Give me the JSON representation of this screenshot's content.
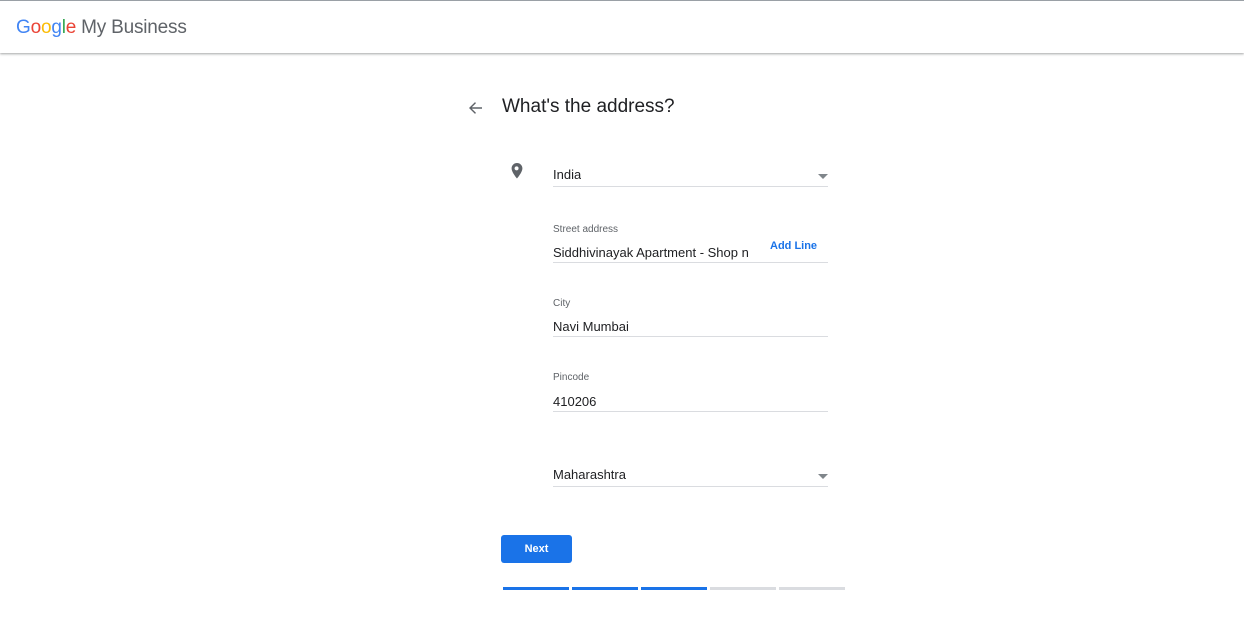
{
  "header": {
    "logo_letters": [
      "G",
      "o",
      "o",
      "g",
      "l",
      "e"
    ],
    "product_name": "My Business"
  },
  "page": {
    "title": "What's the address?"
  },
  "form": {
    "country": {
      "value": "India"
    },
    "street": {
      "label": "Street address",
      "value": "Siddhivinayak Apartment - Shop nc",
      "add_line": "Add Line"
    },
    "city": {
      "label": "City",
      "value": "Navi Mumbai"
    },
    "pincode": {
      "label": "Pincode",
      "value": "410206"
    },
    "state": {
      "value": "Maharashtra"
    }
  },
  "actions": {
    "next_label": "Next"
  },
  "progress": {
    "completed_steps": 3,
    "total_steps": 5,
    "colors": {
      "done": "#1a73e8",
      "pending": "#dadce0"
    }
  },
  "icons": {
    "back": "arrow-back-icon",
    "location": "location-pin-icon",
    "dropdown": "caret-down-icon"
  }
}
